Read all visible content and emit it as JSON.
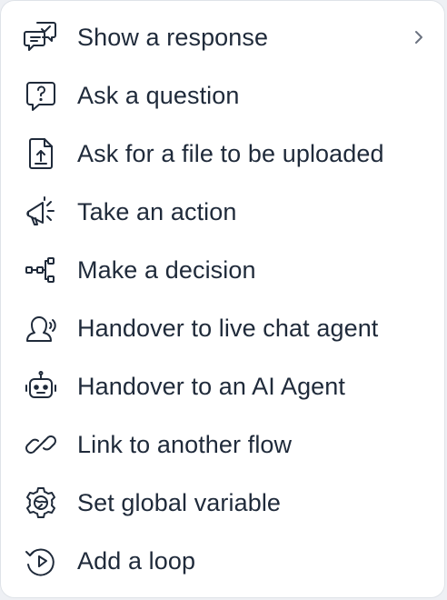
{
  "menu": {
    "items": [
      {
        "label": "Show a response",
        "icon": "chat-response-icon",
        "has_submenu": true
      },
      {
        "label": "Ask a question",
        "icon": "question-bubble-icon"
      },
      {
        "label": "Ask for a file to be uploaded",
        "icon": "file-upload-icon"
      },
      {
        "label": "Take an action",
        "icon": "megaphone-icon"
      },
      {
        "label": "Make a decision",
        "icon": "decision-tree-icon"
      },
      {
        "label": "Handover to live chat agent",
        "icon": "live-agent-icon"
      },
      {
        "label": "Handover to an AI Agent",
        "icon": "robot-icon"
      },
      {
        "label": "Link to another flow",
        "icon": "link-icon"
      },
      {
        "label": "Set global variable",
        "icon": "global-settings-icon"
      },
      {
        "label": "Add a loop",
        "icon": "loop-icon"
      }
    ]
  },
  "colors": {
    "text": "#1f2a3a",
    "chevron": "#6b7280",
    "background": "#ffffff"
  }
}
